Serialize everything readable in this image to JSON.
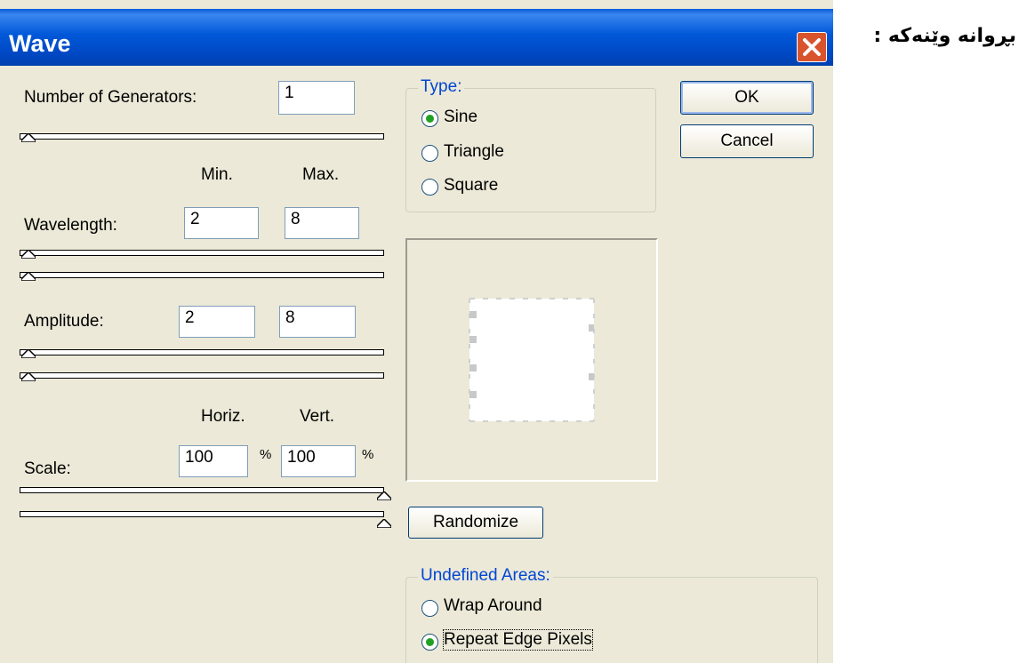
{
  "page": {
    "side_caption": "بڕوانە وێنەکە :"
  },
  "dialog": {
    "title": "Wave",
    "generators": {
      "label": "Number of Generators:",
      "value": "1",
      "slider_level": 0
    },
    "headers": {
      "min": "Min.",
      "max": "Max.",
      "horiz": "Horiz.",
      "vert": "Vert."
    },
    "wavelength": {
      "label": "Wavelength:",
      "min": "2",
      "max": "8"
    },
    "amplitude": {
      "label": "Amplitude:",
      "min": "2",
      "max": "8"
    },
    "scale": {
      "label": "Scale:",
      "horiz": "100",
      "vert": "100",
      "unit": "%"
    },
    "type": {
      "legend": "Type:",
      "options": [
        "Sine",
        "Triangle",
        "Square"
      ],
      "selected": "Sine"
    },
    "undefined_areas": {
      "legend": "Undefined Areas:",
      "options": [
        "Wrap Around",
        "Repeat Edge Pixels"
      ],
      "selected": "Repeat Edge Pixels"
    },
    "buttons": {
      "ok": "OK",
      "cancel": "Cancel",
      "randomize": "Randomize"
    }
  },
  "icons": {
    "close": "close-icon",
    "slider_thumb": "slider-thumb-icon"
  },
  "colors": {
    "titlebar": "#0058d8",
    "dialog_bg": "#ece9d8",
    "close": "#d9532c",
    "group_legend": "#0046d5",
    "radio_dot": "#21a121"
  }
}
